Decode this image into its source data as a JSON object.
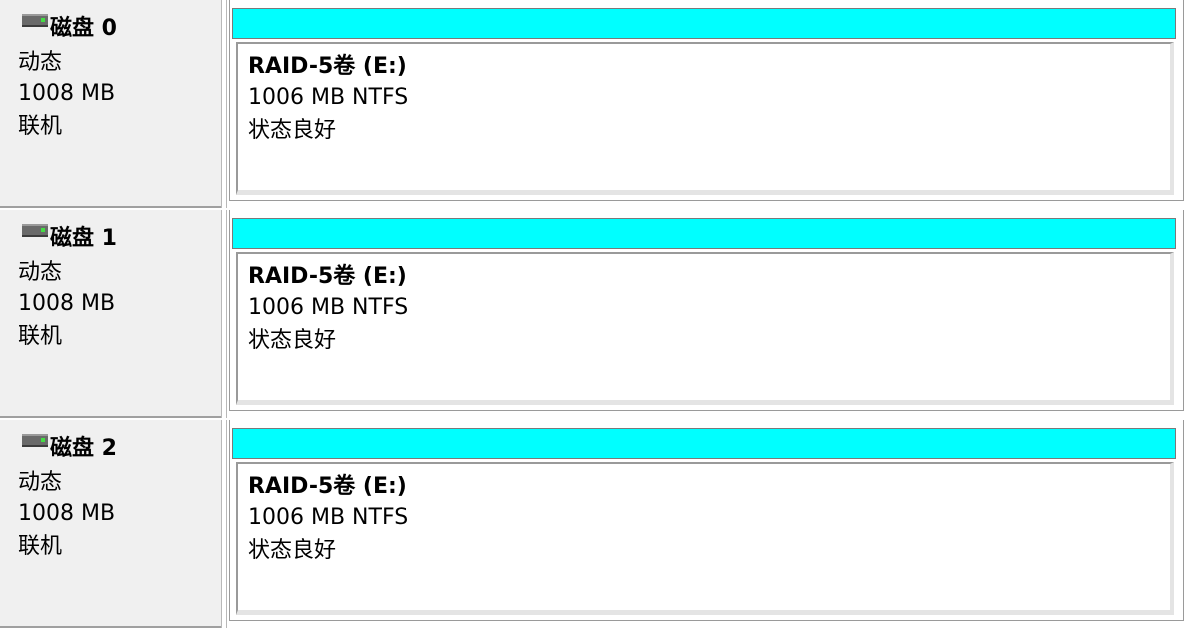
{
  "disks": [
    {
      "title": "磁盘 0",
      "type": "动态",
      "size": "1008 MB",
      "status": "联机",
      "volume": {
        "name": "RAID-5卷  (E:)",
        "size_fs": "1006 MB NTFS",
        "status": "状态良好"
      }
    },
    {
      "title": "磁盘 1",
      "type": "动态",
      "size": "1008 MB",
      "status": "联机",
      "volume": {
        "name": "RAID-5卷  (E:)",
        "size_fs": "1006 MB NTFS",
        "status": "状态良好"
      }
    },
    {
      "title": "磁盘 2",
      "type": "动态",
      "size": "1008 MB",
      "status": "联机",
      "volume": {
        "name": "RAID-5卷  (E:)",
        "size_fs": "1006 MB NTFS",
        "status": "状态良好"
      }
    }
  ],
  "icons": {
    "disk": "disk-drive-icon"
  },
  "colors": {
    "volume_stripe": "#00ffff",
    "disk_panel_bg": "#f0f0f0"
  }
}
